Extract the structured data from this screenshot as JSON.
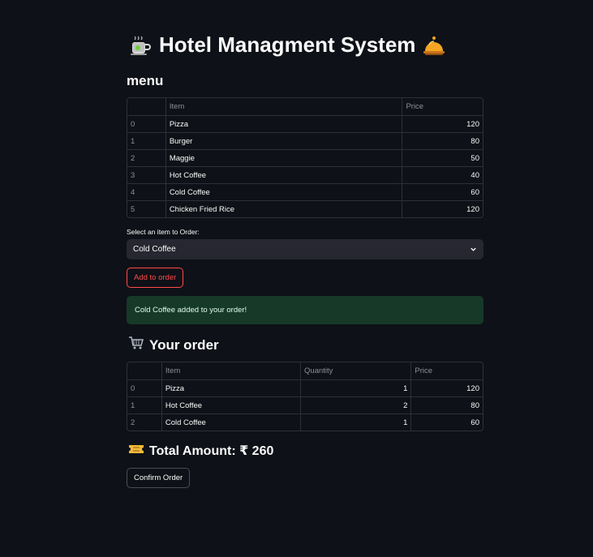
{
  "title": "Hotel Managment System",
  "menu": {
    "heading": "menu",
    "columns": [
      "",
      "Item",
      "Price"
    ],
    "rows": [
      {
        "index": "0",
        "item": "Pizza",
        "price": "120"
      },
      {
        "index": "1",
        "item": "Burger",
        "price": "80"
      },
      {
        "index": "2",
        "item": "Maggie",
        "price": "50"
      },
      {
        "index": "3",
        "item": "Hot Coffee",
        "price": "40"
      },
      {
        "index": "4",
        "item": "Cold Coffee",
        "price": "60"
      },
      {
        "index": "5",
        "item": "Chicken Fried Rice",
        "price": "120"
      }
    ]
  },
  "select": {
    "label": "Select an item to Order:",
    "value": "Cold Coffee"
  },
  "add_button": "Add to order",
  "success_message": "Cold Coffee added to your order!",
  "order": {
    "heading": "Your order",
    "columns": [
      "",
      "Item",
      "Quantity",
      "Price"
    ],
    "rows": [
      {
        "index": "0",
        "item": "Pizza",
        "quantity": "1",
        "price": "120"
      },
      {
        "index": "1",
        "item": "Hot Coffee",
        "quantity": "2",
        "price": "80"
      },
      {
        "index": "2",
        "item": "Cold Coffee",
        "quantity": "1",
        "price": "60"
      }
    ]
  },
  "total": "Total Amount: ₹ 260",
  "confirm_button": "Confirm Order",
  "icons": {
    "title_left": "teacup-icon",
    "title_right": "bellhop-bell-icon",
    "order": "shopping-cart-icon",
    "total": "ticket-icon",
    "select": "chevron-down-icon"
  },
  "colors": {
    "background": "#0e1117",
    "accent": "#ff4b4b",
    "success_bg": "#173928",
    "input_bg": "#262730"
  }
}
